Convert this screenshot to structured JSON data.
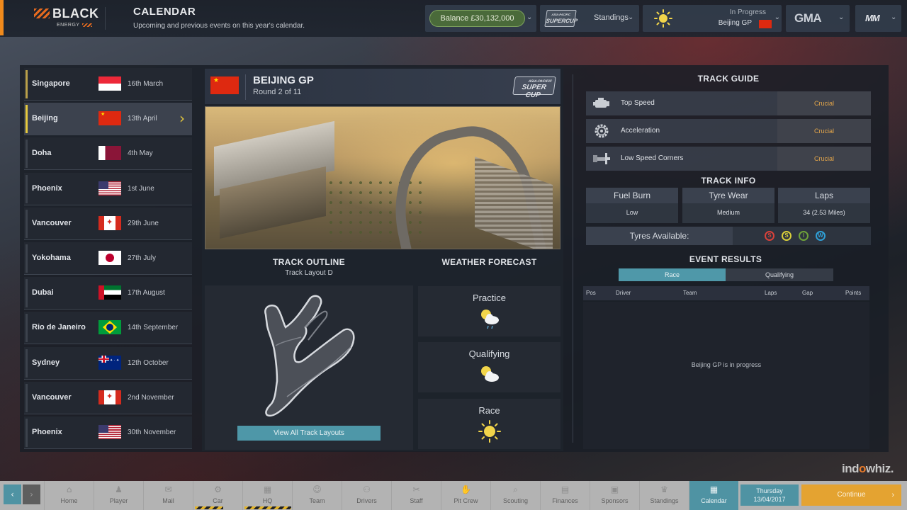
{
  "header": {
    "brand": "BLACK",
    "brand_sub": "ENERGY",
    "title": "CALENDAR",
    "subtitle": "Upcoming and previous events on this year's calendar.",
    "balance_label": "Balance £30,132,000",
    "series_logo_top": "ASIA-PACIFIC",
    "series_logo_bottom": "SUPERCUP",
    "standings_label": "Standings",
    "event_status": "In Progress",
    "event_name": "Beijing GP",
    "team_logo": "GMA",
    "game_logo": "MM"
  },
  "calendar": [
    {
      "city": "Singapore",
      "date": "16th March",
      "flag": "f-sg",
      "state": "past"
    },
    {
      "city": "Beijing",
      "date": "13th April",
      "flag": "f-cn",
      "state": "selected"
    },
    {
      "city": "Doha",
      "date": "4th May",
      "flag": "f-qa",
      "state": "upcoming"
    },
    {
      "city": "Phoenix",
      "date": "1st June",
      "flag": "f-us",
      "state": "upcoming"
    },
    {
      "city": "Vancouver",
      "date": "29th June",
      "flag": "f-ca",
      "state": "upcoming"
    },
    {
      "city": "Yokohama",
      "date": "27th July",
      "flag": "f-jp",
      "state": "upcoming"
    },
    {
      "city": "Dubai",
      "date": "17th August",
      "flag": "f-ae",
      "state": "upcoming"
    },
    {
      "city": "Rio de Janeiro",
      "date": "14th September",
      "flag": "f-br",
      "state": "upcoming"
    },
    {
      "city": "Sydney",
      "date": "12th October",
      "flag": "f-au",
      "state": "upcoming"
    },
    {
      "city": "Vancouver",
      "date": "2nd November",
      "flag": "f-ca",
      "state": "upcoming"
    },
    {
      "city": "Phoenix",
      "date": "30th November",
      "flag": "f-us",
      "state": "upcoming"
    }
  ],
  "event": {
    "title": "BEIJING GP",
    "round": "Round 2 of 11",
    "cup_top": "ASIA-PACIFIC",
    "cup_bottom": "SUPER CUP",
    "track_outline_title": "TRACK OUTLINE",
    "track_layout": "Track Layout D",
    "view_layouts_label": "View All Track Layouts",
    "weather_title": "WEATHER FORECAST",
    "weather": [
      {
        "session": "Practice",
        "icon": "sun-cloud-rain-icon"
      },
      {
        "session": "Qualifying",
        "icon": "sun-cloud-icon"
      },
      {
        "session": "Race",
        "icon": "sun-icon"
      }
    ]
  },
  "track_guide": {
    "title": "TRACK GUIDE",
    "rows": [
      {
        "label": "Top Speed",
        "value": "Crucial",
        "icon": "engine-icon"
      },
      {
        "label": "Acceleration",
        "value": "Crucial",
        "icon": "gear-icon"
      },
      {
        "label": "Low Speed Corners",
        "value": "Crucial",
        "icon": "car-icon"
      }
    ]
  },
  "track_info": {
    "title": "TRACK INFO",
    "cells": [
      {
        "head": "Fuel Burn",
        "value": "Low"
      },
      {
        "head": "Tyre Wear",
        "value": "Medium"
      },
      {
        "head": "Laps",
        "value": "34 (2.53 Miles)"
      }
    ],
    "tyres_label": "Tyres Available:",
    "tyres": [
      {
        "letter": "S",
        "color": "#d8413a",
        "name": "super-soft"
      },
      {
        "letter": "S",
        "color": "#d9cf3a",
        "name": "soft"
      },
      {
        "letter": "I",
        "color": "#6fa23a",
        "name": "intermediate"
      },
      {
        "letter": "W",
        "color": "#2f9fd6",
        "name": "wet"
      }
    ]
  },
  "results": {
    "title": "EVENT RESULTS",
    "tabs": [
      "Race",
      "Qualifying"
    ],
    "columns": [
      "Pos",
      "Driver",
      "Team",
      "Laps",
      "Gap",
      "Points"
    ],
    "message": "Beijing GP is in progress"
  },
  "watermark": {
    "pre": "ind",
    "o": "o",
    "post": "whiz."
  },
  "nav": {
    "back": "‹",
    "forward": "›",
    "items": [
      {
        "label": "Home",
        "icon": "⌂"
      },
      {
        "label": "Player",
        "icon": "♟"
      },
      {
        "label": "Mail",
        "icon": "✉"
      },
      {
        "label": "Car",
        "icon": "⚙"
      },
      {
        "label": "HQ",
        "icon": "▦"
      },
      {
        "label": "Team",
        "icon": "☺"
      },
      {
        "label": "Drivers",
        "icon": "⚇"
      },
      {
        "label": "Staff",
        "icon": "✂"
      },
      {
        "label": "Pit Crew",
        "icon": "✋"
      },
      {
        "label": "Scouting",
        "icon": "⌕"
      },
      {
        "label": "Finances",
        "icon": "▤"
      },
      {
        "label": "Sponsors",
        "icon": "▣"
      },
      {
        "label": "Standings",
        "icon": "♛"
      },
      {
        "label": "Calendar",
        "icon": "▦"
      }
    ],
    "day": "Thursday",
    "date": "13/04/2017",
    "continue_label": "Continue",
    "continue_arrow": "›"
  },
  "colors": {
    "accent_teal": "#4f93a3",
    "accent_orange": "#e4a331",
    "crucial": "#e3a54a",
    "selected_bar": "#e5c93e"
  }
}
